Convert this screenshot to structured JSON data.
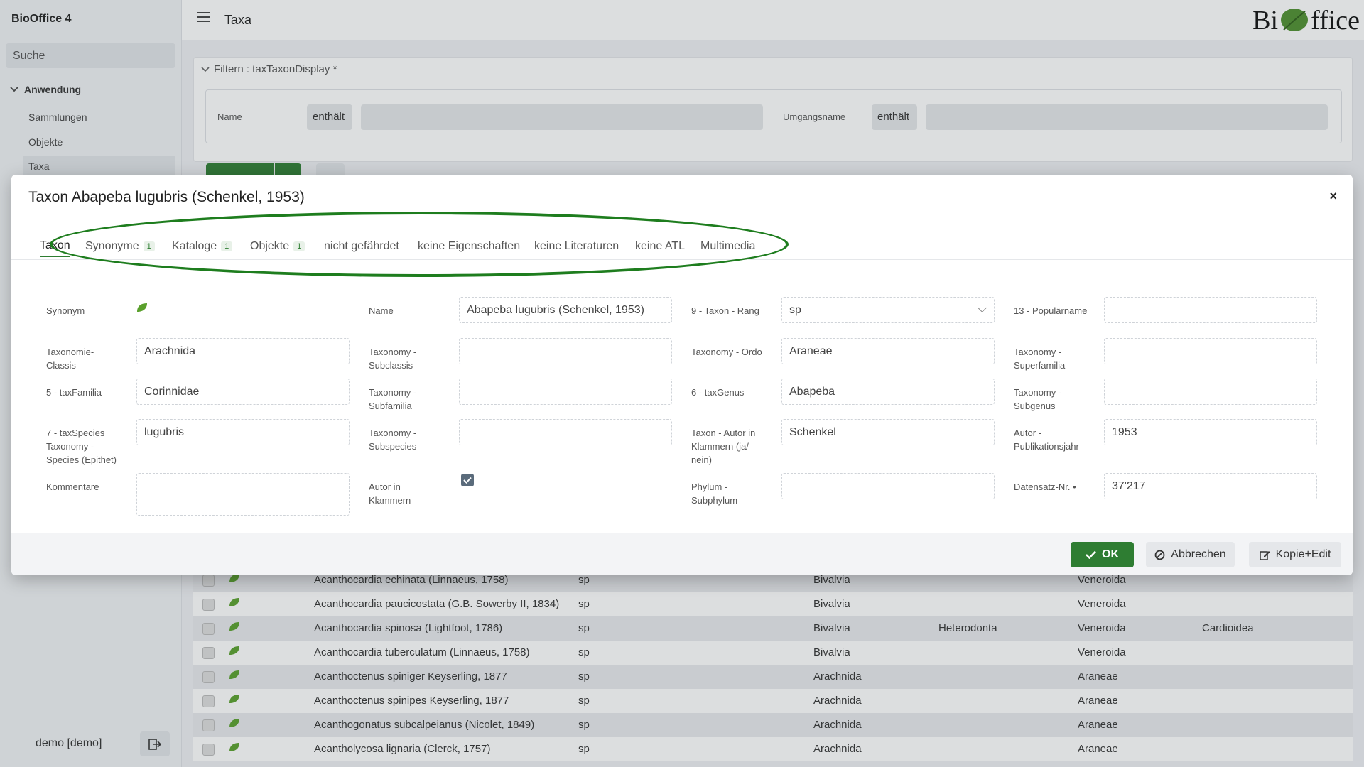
{
  "app": {
    "title": "BioOffice 4",
    "logo_text_left": "Bi",
    "logo_text_right": "ffice"
  },
  "sidebar": {
    "search": "Suche",
    "group": "Anwendung",
    "items": [
      "Sammlungen",
      "Objekte",
      "Taxa"
    ],
    "active": "Taxa",
    "user": "demo [demo]"
  },
  "header": {
    "title": "Taxa"
  },
  "filter": {
    "title": "Filtern : taxTaxonDisplay *",
    "fields": [
      {
        "label": "Name",
        "operator": "enthält",
        "value": ""
      },
      {
        "label": "Umgangsname",
        "operator": "enthält",
        "value": ""
      }
    ]
  },
  "table": {
    "rows": [
      {
        "name": "Acanthocardia echinata (Linnaeus, 1758)",
        "rank": "sp",
        "classis": "Bivalvia",
        "subclassis": "",
        "ordo": "Veneroida",
        "superfamilia": ""
      },
      {
        "name": "Acanthocardia paucicostata (G.B. Sowerby II, 1834)",
        "rank": "sp",
        "classis": "Bivalvia",
        "subclassis": "",
        "ordo": "Veneroida",
        "superfamilia": ""
      },
      {
        "name": "Acanthocardia spinosa (Lightfoot, 1786)",
        "rank": "sp",
        "classis": "Bivalvia",
        "subclassis": "Heterodonta",
        "ordo": "Veneroida",
        "superfamilia": "Cardioidea"
      },
      {
        "name": "Acanthocardia tuberculatum (Linnaeus, 1758)",
        "rank": "sp",
        "classis": "Bivalvia",
        "subclassis": "",
        "ordo": "Veneroida",
        "superfamilia": ""
      },
      {
        "name": "Acanthoctenus spiniger Keyserling, 1877",
        "rank": "sp",
        "classis": "Arachnida",
        "subclassis": "",
        "ordo": "Araneae",
        "superfamilia": ""
      },
      {
        "name": "Acanthoctenus spinipes Keyserling, 1877",
        "rank": "sp",
        "classis": "Arachnida",
        "subclassis": "",
        "ordo": "Araneae",
        "superfamilia": ""
      },
      {
        "name": "Acanthogonatus subcalpeianus (Nicolet, 1849)",
        "rank": "sp",
        "classis": "Arachnida",
        "subclassis": "",
        "ordo": "Araneae",
        "superfamilia": ""
      },
      {
        "name": "Acantholycosa lignaria (Clerck, 1757)",
        "rank": "sp",
        "classis": "Arachnida",
        "subclassis": "",
        "ordo": "Araneae",
        "superfamilia": ""
      }
    ]
  },
  "modal": {
    "title": "Taxon Abapeba lugubris (Schenkel, 1953)",
    "close": "×",
    "tabs": [
      {
        "label": "Taxon",
        "badge": ""
      },
      {
        "label": "Synonyme",
        "badge": "1"
      },
      {
        "label": "Kataloge",
        "badge": "1"
      },
      {
        "label": "Objekte",
        "badge": "1"
      },
      {
        "label": "nicht gefährdet",
        "badge": ""
      },
      {
        "label": "keine Eigenschaften",
        "badge": ""
      },
      {
        "label": "keine Literaturen",
        "badge": ""
      },
      {
        "label": "keine ATL",
        "badge": ""
      },
      {
        "label": "Multimedia",
        "badge": ""
      }
    ],
    "fields": {
      "synonym": {
        "label": "Synonym"
      },
      "name": {
        "label": "Name",
        "value": "Abapeba lugubris (Schenkel, 1953)"
      },
      "rang": {
        "label": "9 - Taxon - Rang",
        "value": "sp"
      },
      "popularname": {
        "label": "13 - Populärname",
        "value": ""
      },
      "classis": {
        "label": "Taxonomie-Classis",
        "value": "Arachnida"
      },
      "subclassis": {
        "label": "Taxonomy - Subclassis",
        "value": ""
      },
      "ordo": {
        "label": "Taxonomy - Ordo",
        "value": "Araneae"
      },
      "superfamilia": {
        "label": "Taxonomy - Superfamilia",
        "value": ""
      },
      "familia": {
        "label": "5 - taxFamilia",
        "value": "Corinnidae"
      },
      "subfamilia": {
        "label": "Taxonomy - Subfamilia",
        "value": ""
      },
      "genus": {
        "label": "6 - taxGenus",
        "value": "Abapeba"
      },
      "subgenus": {
        "label": "Taxonomy - Subgenus",
        "value": ""
      },
      "species": {
        "label": "7 - taxSpecies Taxonomy - Species (Epithet)",
        "value": "lugubris"
      },
      "subspecies": {
        "label": "Taxonomy - Subspecies",
        "value": ""
      },
      "autor_klammern": {
        "label": "Taxon - Autor in Klammern (ja/ nein)",
        "value": "Schenkel"
      },
      "publikationsjahr": {
        "label": "Autor - Publikationsjahr",
        "value": "1953"
      },
      "kommentare": {
        "label": "Kommentare",
        "value": ""
      },
      "autor_in_klammern": {
        "label": "Autor in Klammern",
        "checked": true
      },
      "subphylum": {
        "label": "Phylum - Subphylum",
        "value": ""
      },
      "datensatz": {
        "label": "Datensatz-Nr. •",
        "value": "37'217"
      }
    },
    "buttons": {
      "ok": "OK",
      "cancel": "Abbrechen",
      "copy": "Kopie+Edit"
    }
  },
  "colors": {
    "accent": "#2e7d32",
    "annotation": "#1e7d1e"
  }
}
